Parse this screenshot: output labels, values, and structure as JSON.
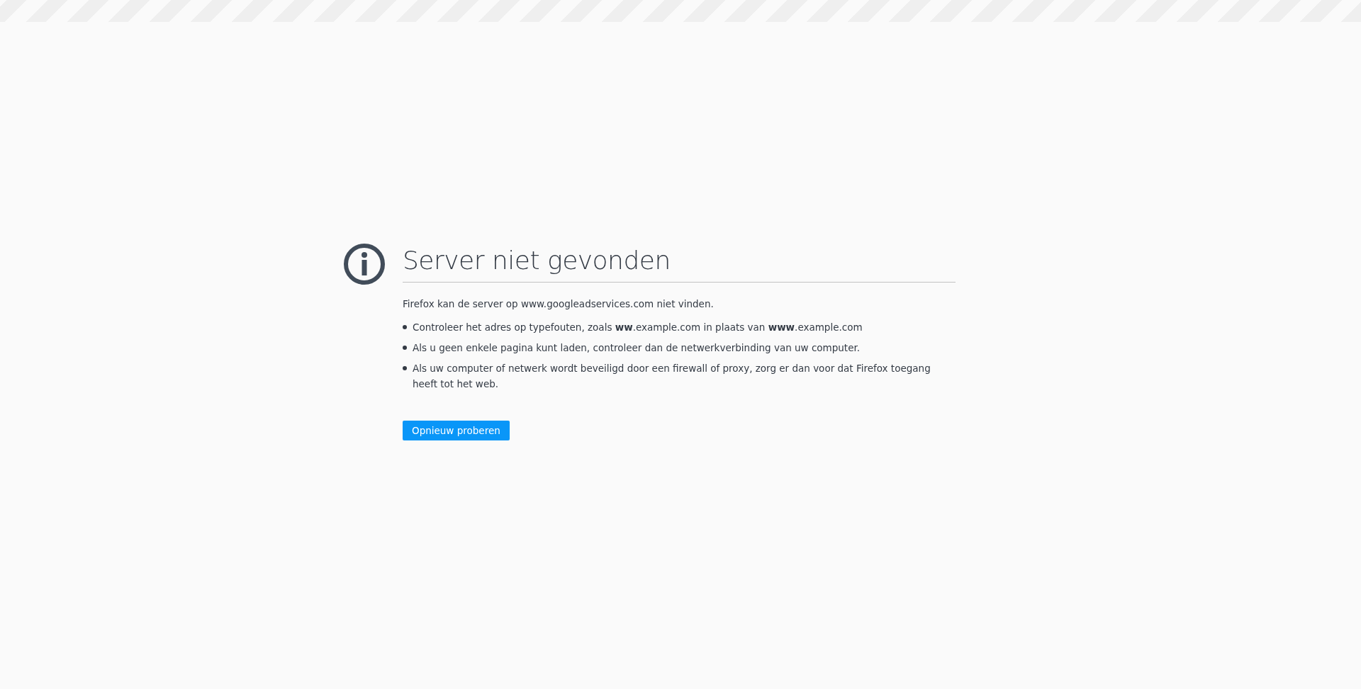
{
  "title": "Server niet gevonden",
  "message": "Firefox kan de server op www.googleadservices.com niet vinden.",
  "suggestions": [
    "Controleer het adres op typefouten, zoals **ww**.example.com in plaats van **www**.example.com",
    "Als u geen enkele pagina kunt laden, controleer dan de netwerkverbinding van uw computer.",
    "Als uw computer of netwerk wordt beveiligd door een firewall of proxy, zorg er dan voor dat Firefox toegang heeft tot het web."
  ],
  "button": "Opnieuw proberen"
}
